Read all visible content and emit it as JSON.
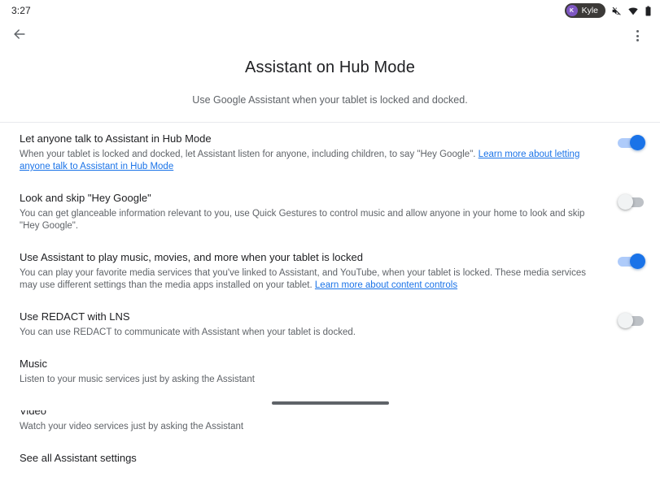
{
  "status_bar": {
    "time": "3:27",
    "user_chip": {
      "avatar_initial": "K",
      "name": "Kyle",
      "avatar_color": "#7e57c2",
      "chip_color": "#3c3a38"
    },
    "icons": [
      "volume-mute-icon",
      "wifi-icon",
      "battery-icon"
    ]
  },
  "app_bar": {
    "back_label": "Back",
    "overflow_label": "More options"
  },
  "header": {
    "title": "Assistant on Hub Mode",
    "subtitle": "Use Google Assistant when your tablet is locked and docked."
  },
  "settings": [
    {
      "title": "Let anyone talk to Assistant in Hub Mode",
      "description": "When your tablet is locked and docked, let Assistant listen for anyone, including children, to say \"Hey Google\". ",
      "link_text": "Learn more about letting anyone talk to Assistant in Hub Mode",
      "toggle": "on"
    },
    {
      "title": "Look and skip \"Hey Google\"",
      "description": "You can get glanceable information relevant to you, use Quick Gestures to control music and allow anyone in your home to look and skip \"Hey Google\".",
      "link_text": "",
      "toggle": "off"
    },
    {
      "title": "Use Assistant to play music, movies, and more when your tablet is locked",
      "description": "You can play your favorite media services that you've linked to Assistant, and YouTube, when your tablet is locked. These media services may use different settings than the media apps installed on your tablet. ",
      "link_text": "Learn more about content controls",
      "toggle": "on"
    },
    {
      "title": "Use REDACT with LNS",
      "description": "You can use REDACT to communicate with Assistant when your tablet is docked.",
      "link_text": "",
      "toggle": "off"
    }
  ],
  "sections": [
    {
      "title": "Music",
      "description": "Listen to your music services just by asking the Assistant"
    },
    {
      "title": "Video",
      "description": "Watch your video services just by asking the Assistant"
    },
    {
      "title": "See all Assistant settings",
      "description": ""
    }
  ],
  "colors": {
    "accent": "#1a73e8",
    "accent_track": "#aecbfa",
    "off_track": "#bdc1c6",
    "text_primary": "#202124",
    "text_secondary": "#5f6368",
    "divider": "#e8eaed"
  }
}
